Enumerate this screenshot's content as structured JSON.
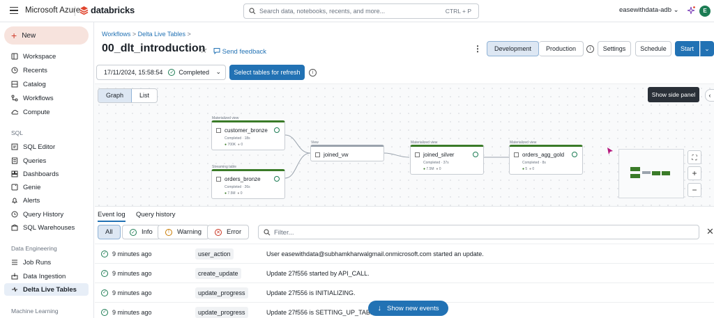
{
  "topbar": {
    "azure_label": "Microsoft Azure",
    "brand": "databricks",
    "search_placeholder": "Search data, notebooks, recents, and more...",
    "search_shortcut": "CTRL + P",
    "workspace": "easewithdata-adb",
    "avatar_initial": "E"
  },
  "sidebar": {
    "new_label": "New",
    "items": [
      {
        "label": "Workspace",
        "icon": "folder-icon"
      },
      {
        "label": "Recents",
        "icon": "clock-icon"
      },
      {
        "label": "Catalog",
        "icon": "catalog-icon"
      },
      {
        "label": "Workflows",
        "icon": "workflows-icon"
      },
      {
        "label": "Compute",
        "icon": "cloud-icon"
      }
    ],
    "sql_header": "SQL",
    "sql_items": [
      {
        "label": "SQL Editor"
      },
      {
        "label": "Queries"
      },
      {
        "label": "Dashboards"
      },
      {
        "label": "Genie"
      },
      {
        "label": "Alerts"
      },
      {
        "label": "Query History"
      },
      {
        "label": "SQL Warehouses"
      }
    ],
    "de_header": "Data Engineering",
    "de_items": [
      {
        "label": "Job Runs"
      },
      {
        "label": "Data Ingestion"
      },
      {
        "label": "Delta Live Tables"
      }
    ],
    "ml_header": "Machine Learning"
  },
  "page": {
    "breadcrumb_1": "Workflows",
    "breadcrumb_2": "Delta Live Tables",
    "sep": ">",
    "title": "00_dlt_introduction",
    "feedback": "Send feedback",
    "btn_development": "Development",
    "btn_production": "Production",
    "btn_settings": "Settings",
    "btn_schedule": "Schedule",
    "btn_start": "Start",
    "update_time": "17/11/2024, 15:58:54",
    "update_status": "Completed",
    "btn_select_tables": "Select tables for refresh"
  },
  "graph": {
    "tab_graph": "Graph",
    "tab_list": "List",
    "tooltip": "Show side panel",
    "nodes": [
      {
        "kind": "Materialized view",
        "name": "customer_bronze",
        "status": "Completed · 18s",
        "m1": "700K",
        "m2": "0"
      },
      {
        "kind": "Streaming table",
        "name": "orders_bronze",
        "status": "Completed · 26s",
        "m1": "7.5M",
        "m2": "0"
      },
      {
        "kind": "View",
        "name": "joined_vw",
        "status": "",
        "m1": "",
        "m2": ""
      },
      {
        "kind": "Materialized view",
        "name": "joined_silver",
        "status": "Completed · 37s",
        "m1": "7.5M",
        "m2": "0"
      },
      {
        "kind": "Materialized view",
        "name": "orders_agg_gold",
        "status": "Completed · 8s",
        "m1": "5",
        "m2": "0"
      }
    ]
  },
  "eventlog": {
    "tab_event": "Event log",
    "tab_query": "Query history",
    "f_all": "All",
    "f_info": "Info",
    "f_warning": "Warning",
    "f_error": "Error",
    "filter_placeholder": "Filter...",
    "rows": [
      {
        "time": "9 minutes ago",
        "type": "user_action",
        "msg": "User easewithdata@subhamkharwalgmail.onmicrosoft.com started an update."
      },
      {
        "time": "9 minutes ago",
        "type": "create_update",
        "msg": "Update 27f556 started by API_CALL."
      },
      {
        "time": "9 minutes ago",
        "type": "update_progress",
        "msg": "Update 27f556 is INITIALIZING."
      },
      {
        "time": "9 minutes ago",
        "type": "update_progress",
        "msg": "Update 27f556 is SETTING_UP_TABLES."
      }
    ],
    "show_new": "Show new events"
  },
  "colors": {
    "accent": "#2272b4",
    "success": "#1c7c54",
    "node_green": "#3a7b28"
  }
}
